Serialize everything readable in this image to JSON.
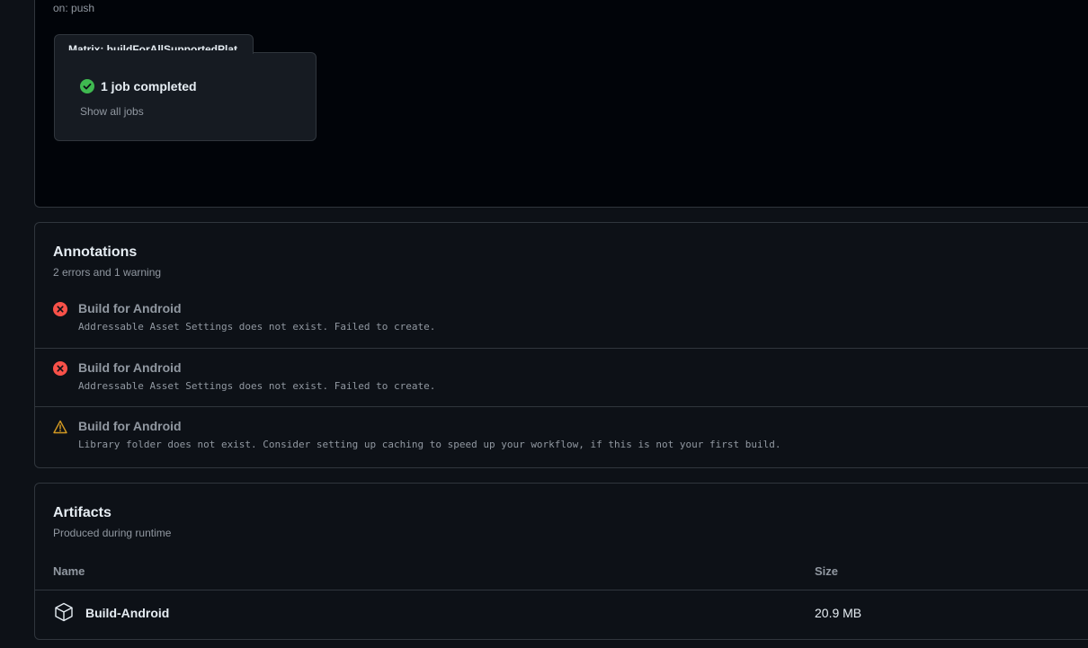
{
  "graph": {
    "trigger": "on: push",
    "matrix_label": "Matrix: buildForAllSupportedPlat...",
    "job_status": "1 job completed",
    "show_jobs": "Show all jobs",
    "success_color": "#3fb950"
  },
  "annotations": {
    "title": "Annotations",
    "subtitle": "2 errors and 1 warning",
    "items": [
      {
        "type": "error",
        "icon": "x-circle-icon",
        "title": "Build for Android",
        "message": "Addressable Asset Settings does not exist. Failed to create."
      },
      {
        "type": "error",
        "icon": "x-circle-icon",
        "title": "Build for Android",
        "message": "Addressable Asset Settings does not exist. Failed to create."
      },
      {
        "type": "warning",
        "icon": "alert-triangle-icon",
        "title": "Build for Android",
        "message": "Library folder does not exist. Consider setting up caching to speed up your workflow, if this is not your first build."
      }
    ],
    "error_color": "#f85149",
    "warning_color": "#d29922"
  },
  "artifacts": {
    "title": "Artifacts",
    "subtitle": "Produced during runtime",
    "columns": {
      "name": "Name",
      "size": "Size"
    },
    "rows": [
      {
        "icon": "package-icon",
        "name": "Build-Android",
        "size": "20.9 MB"
      }
    ]
  }
}
